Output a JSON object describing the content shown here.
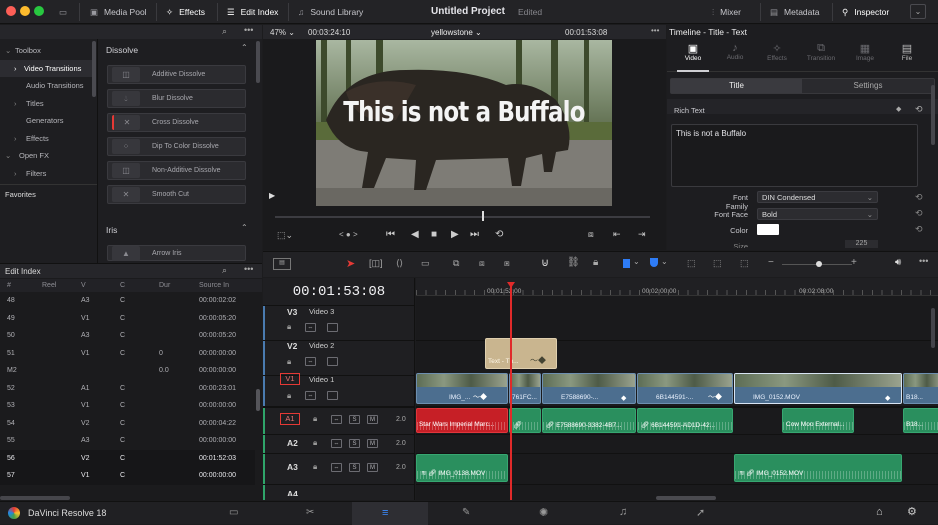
{
  "app": {
    "title": "Untitled Project",
    "status": "Edited",
    "name": "DaVinci Resolve 18"
  },
  "topbar": {
    "media_pool": "Media Pool",
    "effects": "Effects",
    "edit_index": "Edit Index",
    "sound_library": "Sound Library",
    "mixer": "Mixer",
    "metadata": "Metadata",
    "inspector": "Inspector"
  },
  "effects_panel": {
    "tree": [
      "Toolbox",
      "Video Transitions",
      "Audio Transitions",
      "Titles",
      "Generators",
      "Effects",
      "Open FX",
      "Filters"
    ],
    "favorites": "Favorites",
    "dissolve_header": "Dissolve",
    "dissolves": [
      "Additive Dissolve",
      "Blur Dissolve",
      "Cross Dissolve",
      "Dip To Color Dissolve",
      "Non-Additive Dissolve",
      "Smooth Cut"
    ],
    "iris_header": "Iris",
    "iris": [
      "Arrow Iris"
    ]
  },
  "viewer": {
    "zoom": "47%",
    "source_tc": "00:03:24:10",
    "clip_name": "yellowstone",
    "record_tc": "00:01:53:08",
    "overlay_text": "This is not a Buffalo",
    "dots": "< ● >"
  },
  "inspector": {
    "title": "Timeline - Title - Text",
    "tabs": [
      "Video",
      "Audio",
      "Effects",
      "Transition",
      "Image",
      "File"
    ],
    "subtabs": [
      "Title",
      "Settings"
    ],
    "rich_text_label": "Rich Text",
    "rich_text_value": "This is not a Buffalo",
    "font_family_label": "Font Family",
    "font_family_value": "DIN Condensed",
    "font_face_label": "Font Face",
    "font_face_value": "Bold",
    "color_label": "Color",
    "size_label": "Size",
    "size_value": "225"
  },
  "edit_index": {
    "title": "Edit Index",
    "columns": [
      "#",
      "Reel",
      "V",
      "C",
      "Dur",
      "Source In"
    ],
    "rows": [
      [
        "48",
        "",
        "A3",
        "C",
        "",
        "00:00:02:02"
      ],
      [
        "49",
        "",
        "V1",
        "C",
        "",
        "00:00:05:20"
      ],
      [
        "50",
        "",
        "A3",
        "C",
        "",
        "00:00:05:20"
      ],
      [
        "51",
        "",
        "V1",
        "C",
        "0",
        "00:00:00:00"
      ],
      [
        "M2",
        "",
        "",
        "",
        "0.0",
        "00:00:00:00"
      ],
      [
        "52",
        "",
        "A1",
        "C",
        "",
        "00:00:23:01"
      ],
      [
        "53",
        "",
        "V1",
        "C",
        "",
        "00:00:00:00"
      ],
      [
        "54",
        "",
        "V2",
        "C",
        "",
        "00:00:04:22"
      ],
      [
        "55",
        "",
        "A3",
        "C",
        "",
        "00:00:00:00"
      ],
      [
        "56",
        "",
        "V2",
        "C",
        "",
        "00:01:52:03"
      ],
      [
        "57",
        "",
        "V1",
        "C",
        "",
        "00:00:00:00"
      ]
    ]
  },
  "timeline": {
    "timecode": "00:01:53:08",
    "ruler": [
      "00:01:52:00",
      "00:02:00:00",
      "00:02:08:00"
    ],
    "tracks": {
      "v3": {
        "id": "V3",
        "name": "Video 3"
      },
      "v2": {
        "id": "V2",
        "name": "Video 2"
      },
      "v1": {
        "id": "V1",
        "name": "Video 1"
      },
      "a1": {
        "id": "A1",
        "level": "2.0"
      },
      "a2": {
        "id": "A2",
        "level": "2.0"
      },
      "a3": {
        "id": "A3",
        "level": "2.0"
      },
      "a4": {
        "id": "A4"
      }
    },
    "mute_label": "M",
    "solo_label": "S",
    "title_clip": "Text - Th...",
    "video_clips": [
      "IMG_...",
      "761FC...",
      "E7588690-...",
      "6B144591-...",
      "IMG_0152.MOV",
      "B18..."
    ],
    "audio_a1": [
      "Star Wars Imperial Marc...",
      "",
      "E7588690-3382-4B7...",
      "6B144591-AD1D-42...",
      "Cow Moo External...",
      "B18..."
    ],
    "audio_a3": [
      "IMG_0138.MOV",
      "IMG_0152.MOV"
    ]
  },
  "colors": {
    "accent_blue": "#2e7cf6",
    "playhead": "#e02a2a",
    "video_clip": "#4c6e8f",
    "audio_clip": "#2a8f5e",
    "title_clip": "#c9b58f"
  }
}
